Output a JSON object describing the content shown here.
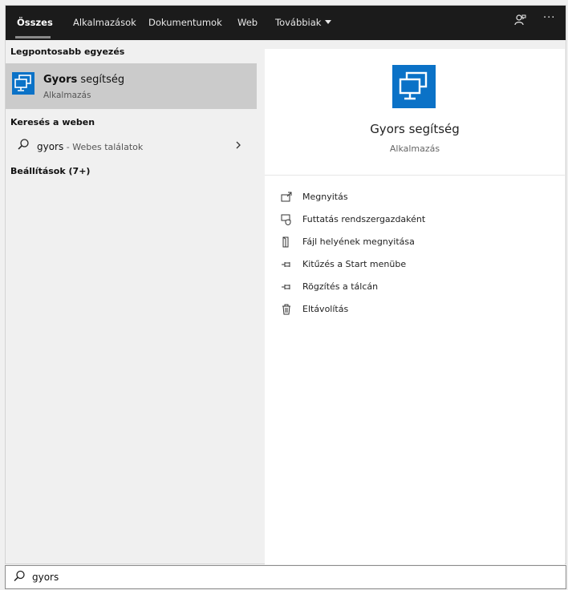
{
  "nav": {
    "tabs": [
      {
        "label": "Összes",
        "active": true
      },
      {
        "label": "Alkalmazások"
      },
      {
        "label": "Dokumentumok"
      },
      {
        "label": "Web"
      },
      {
        "label": "Továbbiak"
      }
    ],
    "right_icons": [
      "feedback-icon",
      "more-options-icon"
    ],
    "more_glyph": "···"
  },
  "left": {
    "best_match_title": "Legpontosabb egyezés",
    "best_match": {
      "name_bold": "Gyors",
      "name_rest": " segítség",
      "type": "Alkalmazás",
      "icon": "remote-desktop-monitor-icon"
    },
    "web_title": "Keresés a weben",
    "web_query": "gyors",
    "web_hint": " - Webes találatok",
    "settings_title": "Beállítások (7+)"
  },
  "preview": {
    "title": "Gyors segítség",
    "subtitle": "Alkalmazás",
    "icon": "remote-desktop-monitor-icon",
    "actions": [
      {
        "label": "Megnyitás",
        "icon": "open-icon"
      },
      {
        "label": "Futtatás rendszergazdaként",
        "icon": "run-as-admin-icon"
      },
      {
        "label": "Fájl helyének megnyitása",
        "icon": "file-location-icon"
      },
      {
        "label": "Kitűzés a Start menübe",
        "icon": "pin-icon"
      },
      {
        "label": "Rögzítés a tálcán",
        "icon": "pin-icon"
      },
      {
        "label": "Eltávolítás",
        "icon": "trash-icon"
      }
    ]
  },
  "search": {
    "value": "gyors",
    "icon": "search-icon"
  },
  "colors": {
    "nav_bg": "#1b1b1b",
    "accent": "#0b72c7",
    "selected_bg": "#cbcbcb"
  }
}
